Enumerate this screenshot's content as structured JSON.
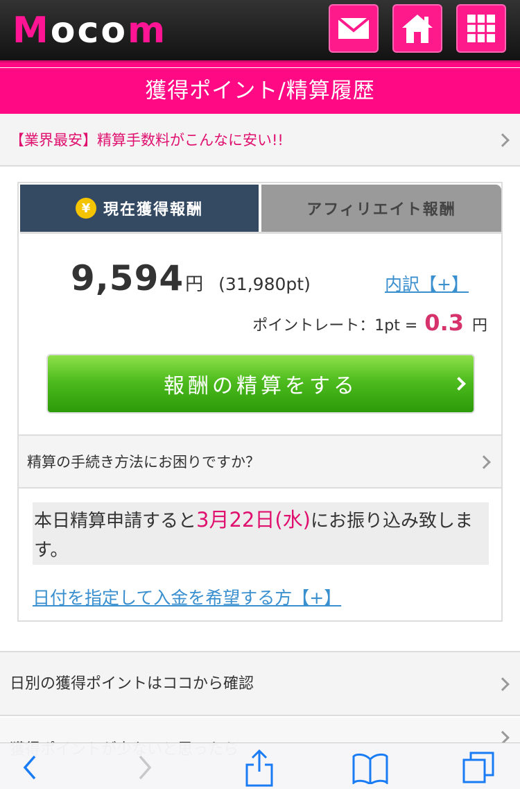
{
  "header": {
    "logo_text": "Mocom",
    "icons": [
      "mail-icon",
      "home-icon",
      "menu-grid-icon"
    ]
  },
  "title": "獲得ポイント/精算履歴",
  "promo": {
    "text": "【業界最安】精算手数料がこんなに安い!!"
  },
  "tabs": {
    "active": {
      "icon": "yen-coin-icon",
      "coin_symbol": "¥",
      "label": "現在獲得報酬"
    },
    "inactive": {
      "label": "アフィリエイト報酬"
    }
  },
  "reward": {
    "amount": "9,594",
    "unit": "円",
    "points": "(31,980pt)",
    "breakdown_link": "内訳【+】",
    "rate_label": "ポイントレート：1pt =",
    "rate_value": "0.3",
    "rate_unit": "円"
  },
  "settle_button": {
    "label": "報酬の精算をする"
  },
  "help": {
    "text": "精算の手続き方法にお困りですか？"
  },
  "notice": {
    "prefix": "本日精算申請すると",
    "date": "3月22日(水)",
    "suffix": "にお振り込み致します。"
  },
  "date_link": "日付を指定して入金を希望する方【+】",
  "daily_link": "日別の獲得ポイントはココから確認",
  "partial_link": "獲得ポイントが少ないと思ったら",
  "browser_bar": {
    "icons": [
      "back-icon",
      "forward-icon",
      "share-icon",
      "bookmarks-icon",
      "tabs-icon"
    ]
  }
}
